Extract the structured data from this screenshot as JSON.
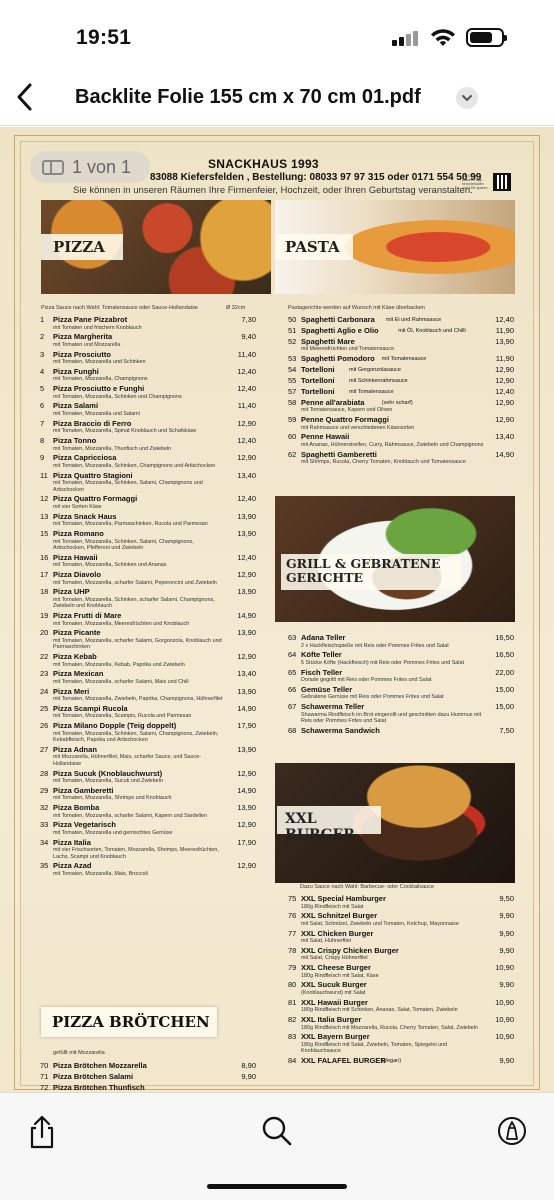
{
  "status_bar": {
    "time": "19:51"
  },
  "nav": {
    "title": "Backlite Folie 155 cm x 70 cm 01.pdf"
  },
  "page_indicator": "1 von 1",
  "header": {
    "shop_name": "SNACKHAUS 1993",
    "address": "83088 Kiefersfelden , Bestellung: 08033 97 97 315  oder  0171 554 50 99",
    "subtitle": "Sie können in unseren Räumen Ihre Firmenfeier, Hochzeit, oder Ihren Geburtstag veranstalten.",
    "qr_note": "QR Code scannen App herunterladen und 15% sparen."
  },
  "banners": {
    "pizza": "PIZZA",
    "pasta": "PASTA",
    "grill": "GRILL & GEBRATENE GERICHTE",
    "burger": "XXL BURGER",
    "pizza_broetchen": "PIZZA BRÖTCHEN"
  },
  "notes": {
    "pizza": "Pizza Sauce nach Wahl: Tomatensauce oder Sauce-Hollandaise",
    "pizza_size": "Ø 32cm",
    "pasta": "Pastagerichte werden auf Wunsch mit Käse überbacken",
    "burger": "Dazu Sauce nach Wahl: Barbecue- oder Cocktailsauce",
    "pizza_broetchen": "gefüllt mit Mozzarella"
  },
  "pizza_items": [
    {
      "num": "1",
      "name": "Pizza Pane Pizzabrot",
      "price": "7,30",
      "desc": "mit Tomaten und frischem Knoblauch"
    },
    {
      "num": "2",
      "name": "Pizza Margherita",
      "price": "9,40",
      "desc": "mit Tomaten und Mozzarella"
    },
    {
      "num": "3",
      "name": "Pizza Prosciutto",
      "price": "11,40",
      "desc": "mit Tomaten, Mozzarella und Schinken"
    },
    {
      "num": "4",
      "name": "Pizza Funghi",
      "price": "12,40",
      "desc": "mit Tomaten, Mozzarella, Champignons"
    },
    {
      "num": "5",
      "name": "Pizza Prosciutto e Funghi",
      "price": "12,40",
      "desc": "mit Tomaten, Mozzarella, Schinken und Champignons"
    },
    {
      "num": "6",
      "name": "Pizza Salami",
      "price": "11,40",
      "desc": "mit Tomaten, Mozzarella und Salami"
    },
    {
      "num": "7",
      "name": "Pizza Braccio di Ferro",
      "price": "12,90",
      "desc": "mit Tomaten, Mozzarella, Spinat Knoblauch und Schafskäse"
    },
    {
      "num": "8",
      "name": "Pizza Tonno",
      "price": "12,40",
      "desc": "mit Tomaten, Mozzarella, Thunfisch und Zwiebeln"
    },
    {
      "num": "9",
      "name": "Pizza Capricciosa",
      "price": "12,90",
      "desc": "mit Tomaten, Mozzarella, Schinken, Champignons und Artischocken"
    },
    {
      "num": "11",
      "name": "Pizza Quattro Stagioni",
      "price": "13,40",
      "desc": "mit Tomaten, Mozzarella, Schinken, Salami, Champignons und Artischocken"
    },
    {
      "num": "12",
      "name": "Pizza Quattro Formaggi",
      "price": "12,40",
      "desc": "mit vier Sorten Käse"
    },
    {
      "num": "13",
      "name": "Pizza Snack Haus",
      "price": "13,90",
      "desc": "mit Tomaten, Mozzarella, Parmaschinken, Rucola und Parmesan"
    },
    {
      "num": "15",
      "name": "Pizza Romano",
      "price": "13,90",
      "desc": "mit Tomaten, Mozzarella, Schinken, Salami, Champignons, Artischocken, Pfefferoni und Zwiebeln"
    },
    {
      "num": "16",
      "name": "Pizza Hawaii",
      "price": "12,40",
      "desc": "mit Tomaten, Mozzarella, Schinken und Ananas"
    },
    {
      "num": "17",
      "name": "Pizza Diavolo",
      "price": "12,90",
      "desc": "mit Tomaten, Mozzarella, scharfer Salami, Peperoncini und Zwiebeln"
    },
    {
      "num": "18",
      "name": "Pizza UHP",
      "price": "13,90",
      "desc": "mit Tomaten, Mozzarella, Schinken, scharfer Salami, Champignons, Zwiebeln und Knoblauch"
    },
    {
      "num": "19",
      "name": "Pizza Frutti di Mare",
      "price": "14,90",
      "desc": "mit Tomaten, Mozzarella, Meeresfrüchten und Knoblauch"
    },
    {
      "num": "20",
      "name": "Pizza Picante",
      "price": "13,90",
      "desc": "mit Tomaten, Mozzarella, scharfer Salami, Gorgonzola, Knoblauch und Parmaschinken"
    },
    {
      "num": "22",
      "name": "Pizza Kebab",
      "price": "12,90",
      "desc": "mit Tomaten, Mozzarella, Kebab, Paprika und Zwiebeln"
    },
    {
      "num": "23",
      "name": "Pizza Mexican",
      "price": "13,40",
      "desc": "mit Tomaten, Mozzarella, scharfer Salami, Mais und Chili"
    },
    {
      "num": "24",
      "name": "Pizza Meri",
      "price": "13,90",
      "desc": "mit Tomaten, Mozzarella, Zwiebeln, Paprika, Champignons, Hühnerfilet"
    },
    {
      "num": "25",
      "name": "Pizza Scampi Rucola",
      "price": "14,90",
      "desc": "mit Tomaten, Mozzarella, Scampis, Rucola und Parmesan"
    },
    {
      "num": "26",
      "name": "Pizza Milano Dopple (Teig doppelt)",
      "price": "17,90",
      "desc": "mit Tomaten, Mozzarella, Schinken, Salami, Champignons, Zwiebeln, Kebabfleisch, Paprika und Artischocken"
    },
    {
      "num": "27",
      "name": "Pizza Adnan",
      "price": "13,90",
      "desc": "mit Mozzarella, Hühnerfilet, Mais, scharfer Sauce, und Sauce-Hollandaise"
    },
    {
      "num": "28",
      "name": "Pizza Sucuk (Knoblauchwurst)",
      "price": "12,90",
      "desc": "mit Tomaten, Mozzarella, Sucuk und Zwiebeln"
    },
    {
      "num": "29",
      "name": "Pizza Gamberetti",
      "price": "14,90",
      "desc": "mit Tomaten, Mozzarella, Shrimps und Knoblauch"
    },
    {
      "num": "32",
      "name": "Pizza Bomba",
      "price": "13,90",
      "desc": "mit Tomaten, Mozzarella, scharfer Salami, Kapern und Sardellen"
    },
    {
      "num": "33",
      "name": "Pizza Vegetarisch",
      "price": "12,90",
      "desc": "mit Tomaten, Mozzarella und gemischtes Gemüse"
    },
    {
      "num": "34",
      "name": "Pizza Italia",
      "price": "17,90",
      "desc": "mit vier Frischsorten, Tomaten, Mozzarella, Shrimps, Meeresfrüchten, Lachs, Scampi und Knoblauch"
    },
    {
      "num": "35",
      "name": "Pizza Azad",
      "price": "12,90",
      "desc": "mit Tomaten, Mozzarella, Mais, Broccoli"
    }
  ],
  "broetchen_items": [
    {
      "num": "70",
      "name": "Pizza Brötchen Mozzarella",
      "price": "8,90"
    },
    {
      "num": "71",
      "name": "Pizza Brötchen Salami",
      "price": "9,90"
    },
    {
      "num": "72",
      "name": "Pizza Brötchen Thunfisch",
      "price": ""
    }
  ],
  "pasta_items": [
    {
      "num": "50",
      "name": "Spaghetti Carbonara",
      "extra": "mit Ei und Rahmsauce",
      "price": "12,40",
      "desc": ""
    },
    {
      "num": "51",
      "name": "Spaghetti Aglio e Olio",
      "extra": "mit Öl, Knoblauch und Chilli",
      "price": "11,90",
      "desc": ""
    },
    {
      "num": "52",
      "name": "Spaghetti Mare",
      "extra": "",
      "price": "13,90",
      "desc": "mit Meeresfrüchten und Tomatensauce"
    },
    {
      "num": "53",
      "name": "Spaghetti Pomodoro",
      "extra": "mit Tomatensauce",
      "price": "11,90",
      "desc": ""
    },
    {
      "num": "54",
      "name": "Tortelloni",
      "extra": "mit Gorgonzolasauce",
      "price": "12,90",
      "desc": ""
    },
    {
      "num": "55",
      "name": "Tortelloni",
      "extra": "mit Schinkenrahmsauce",
      "price": "12,90",
      "desc": ""
    },
    {
      "num": "57",
      "name": "Tortelloni",
      "extra": "mit Tomatensauce",
      "price": "12,40",
      "desc": ""
    },
    {
      "num": "58",
      "name": "Penne all'arabiata",
      "extra": "(sehr scharf)",
      "price": "12,90",
      "desc": "mit Tomatensauce, Kapern und Oliven"
    },
    {
      "num": "59",
      "name": "Penne Quattro Formaggi",
      "extra": "",
      "price": "12,90",
      "desc": "mit Rahmsauce und verschiedenen Käsesorten"
    },
    {
      "num": "60",
      "name": "Penne Hawaii",
      "extra": "",
      "price": "13,40",
      "desc": "mit Ananas, Hühnerstreifen, Curry, Rahmsauce, Zwiebeln und Champignons"
    },
    {
      "num": "62",
      "name": "Spaghetti Gamberetti",
      "extra": "",
      "price": "14,90",
      "desc": "mit Shrimps, Rucola, Cherry Tomaten, Knoblauch und Tomatensauce"
    }
  ],
  "grill_items": [
    {
      "num": "63",
      "name": "Adana Teller",
      "price": "16,50",
      "desc": "2 x Hackfleischspieße mit Reis oder Pommes Frites und Salat"
    },
    {
      "num": "64",
      "name": "Köfte Teller",
      "price": "16,50",
      "desc": "5 Stücke Köfte (Hackfleisch) mit Reis oder Pommes Frites und Salat"
    },
    {
      "num": "65",
      "name": "Fisch Teller",
      "price": "22,00",
      "desc": "Dorade gegrillt mit Reis oder Pommes Frites und Salat"
    },
    {
      "num": "66",
      "name": "Gemüse Teller",
      "price": "15,00",
      "desc": "Gebratene Gemüse mit Reis oder Pommes Frites und Salat"
    },
    {
      "num": "67",
      "name": "Schawerma Teller",
      "price": "15,00",
      "desc": "Shawarma Rindfleisch im Brot eingerollt und geschnitten dazu Hummus mit Reis oder Pommes Frites und Salat"
    },
    {
      "num": "68",
      "name": "Schawerma Sandwich",
      "price": "7,50",
      "desc": ""
    }
  ],
  "burger_items": [
    {
      "num": "75",
      "name": "XXL Special Hamburger",
      "price": "9,50",
      "desc": "180g Rindfleisch mit Salat"
    },
    {
      "num": "76",
      "name": "XXL Schnitzel Burger",
      "price": "9,90",
      "desc": "mit Salat, Schnitzel, Zwiebeln und Tomaten, Ketchup, Mayonnaise"
    },
    {
      "num": "77",
      "name": "XXL Chicken Burger",
      "price": "9,90",
      "desc": "mit Salat, Hühnerfilet"
    },
    {
      "num": "78",
      "name": "XXL Crispy Chicken Burger",
      "price": "9,90",
      "desc": "mit Salat, Crispy Hühnerfilet"
    },
    {
      "num": "79",
      "name": "XXL Cheese Burger",
      "price": "10,90",
      "desc": "180g Rindfleisch mit Salat, Käse"
    },
    {
      "num": "80",
      "name": "XXL Sucuk Burger",
      "price": "9,90",
      "desc": "(Knoblauchwurst) mit Salat"
    },
    {
      "num": "81",
      "name": "XXL Hawaii Burger",
      "price": "10,90",
      "desc": "180g Rindfleisch mit Schinken, Ananas, Salat, Tomaten, Zwiebeln"
    },
    {
      "num": "82",
      "name": "XXL Italia Burger",
      "price": "10,90",
      "desc": "180g Rindfleisch mit Mozzarella, Rucola, Cherry Tomaten, Salat, Zwiebeln"
    },
    {
      "num": "83",
      "name": "XXL Bayern Burger",
      "price": "10,90",
      "desc": "180g Rindfleisch mit Salat, Zwiebeln, Tomaten, Spiegelei und Knoblauchsauce"
    },
    {
      "num": "84",
      "name": "XXL FALAFEL BURGER",
      "extra": "(Vegan)",
      "price": "9,90",
      "desc": ""
    }
  ],
  "icons": {
    "back": "chevron-left-icon",
    "dropdown": "chevron-down-icon",
    "share": "share-icon",
    "search": "search-icon",
    "markup": "markup-icon"
  },
  "colors": {
    "accent": "#b99a58",
    "paper": "#f1e6cc"
  }
}
